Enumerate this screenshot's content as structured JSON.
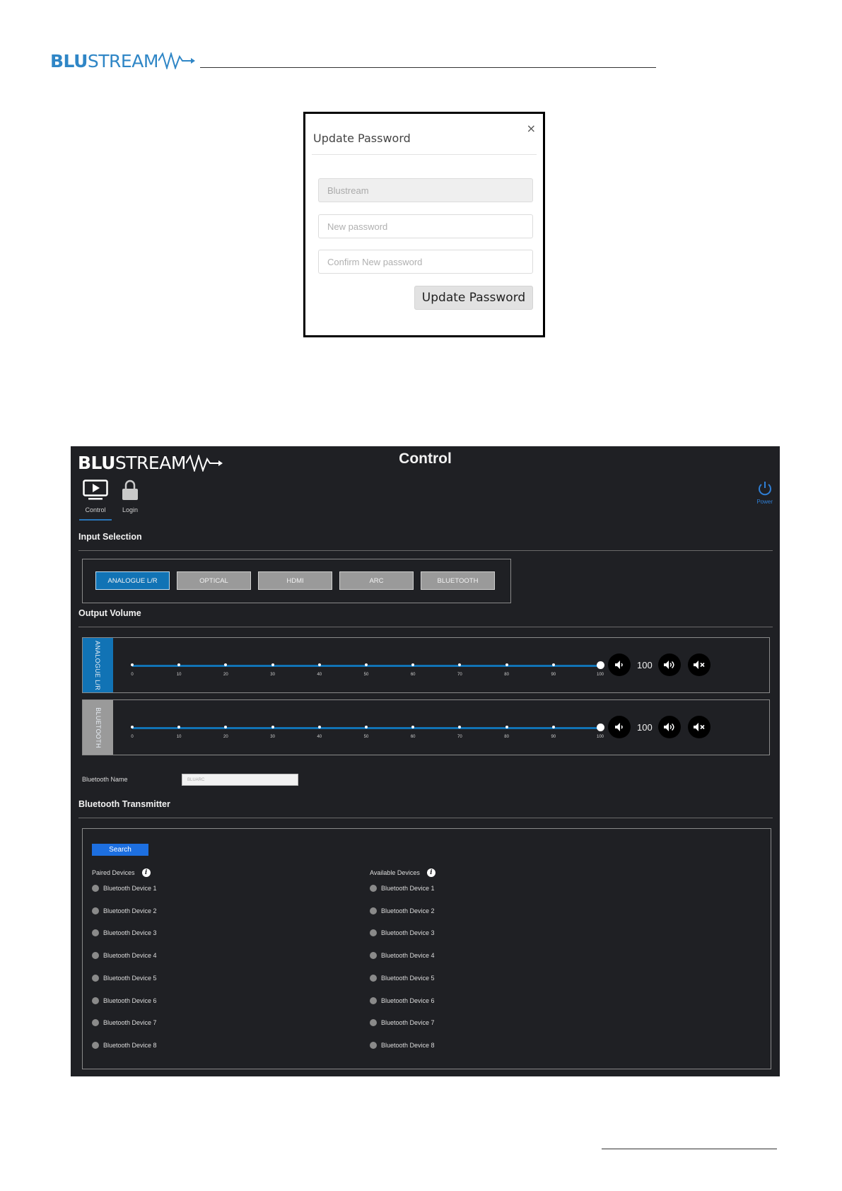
{
  "document": {
    "logo_bold": "BLU",
    "logo_light": "STREAM"
  },
  "modal": {
    "title": "Update Password",
    "close_glyph": "×",
    "fields": {
      "username_value": "Blustream",
      "new_password_placeholder": "New password",
      "confirm_password_placeholder": "Confirm New password"
    },
    "submit_label": "Update Password"
  },
  "app": {
    "logo_bold": "BLU",
    "logo_light": "STREAM",
    "title": "Control",
    "nav": [
      {
        "label": "Control",
        "icon": "monitor-play-icon",
        "active": true
      },
      {
        "label": "Login",
        "icon": "lock-icon",
        "active": false
      }
    ],
    "power_label": "Power",
    "input_selection": {
      "title": "Input Selection",
      "buttons": [
        {
          "label": "ANALOGUE L/R",
          "active": true
        },
        {
          "label": "OPTICAL",
          "active": false
        },
        {
          "label": "HDMI",
          "active": false
        },
        {
          "label": "ARC",
          "active": false
        },
        {
          "label": "BLUETOOTH",
          "active": false
        }
      ]
    },
    "output_volume": {
      "title": "Output Volume",
      "scale": [
        "0",
        "10",
        "20",
        "30",
        "40",
        "50",
        "60",
        "70",
        "80",
        "90",
        "100"
      ],
      "channels": [
        {
          "label": "ANALOGUE L/R",
          "value": 100,
          "display": "100",
          "accent": "#1173b5"
        },
        {
          "label": "BLUETOOTH",
          "value": 100,
          "display": "100",
          "accent": "#9a9a9a"
        }
      ]
    },
    "bluetooth_name": {
      "label": "Bluetooth Name",
      "value": "BLUARC"
    },
    "bluetooth_transmitter": {
      "title": "Bluetooth Transmitter",
      "search_label": "Search",
      "paired_title": "Paired Devices",
      "available_title": "Available Devices",
      "info_glyph": "i",
      "paired": [
        "Bluetooth Device 1",
        "Bluetooth Device 2",
        "Bluetooth Device 3",
        "Bluetooth Device 4",
        "Bluetooth Device 5",
        "Bluetooth Device 6",
        "Bluetooth Device 7",
        "Bluetooth Device 8"
      ],
      "available": [
        "Bluetooth Device 1",
        "Bluetooth Device 2",
        "Bluetooth Device 3",
        "Bluetooth Device 4",
        "Bluetooth Device 5",
        "Bluetooth Device 6",
        "Bluetooth Device 7",
        "Bluetooth Device 8"
      ]
    }
  }
}
